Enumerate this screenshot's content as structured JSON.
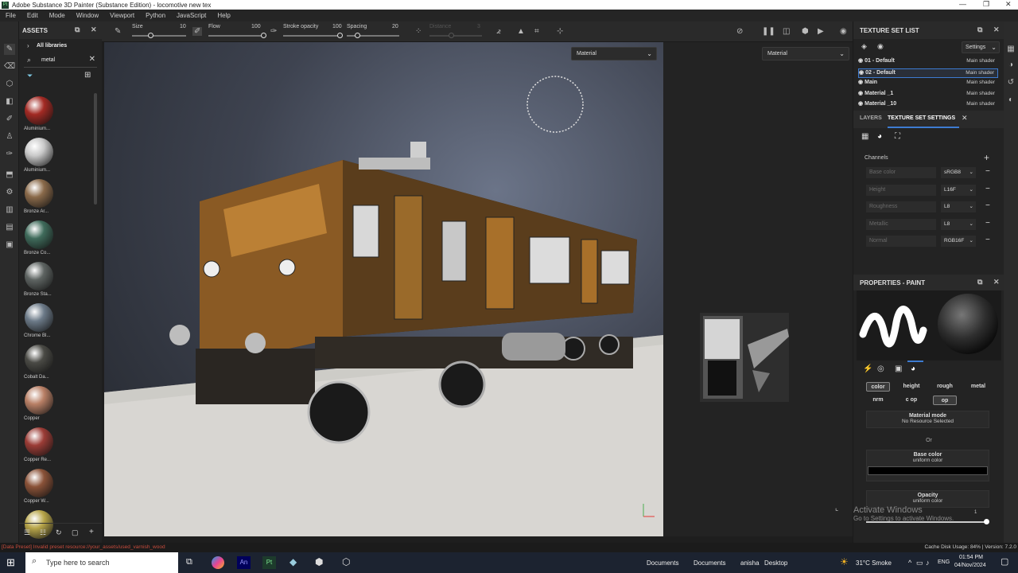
{
  "window": {
    "title": "Adobe Substance 3D Painter (Substance Edition) - locomotive new tex",
    "logo": "Pt"
  },
  "menu": [
    "File",
    "Edit",
    "Mode",
    "Window",
    "Viewport",
    "Python",
    "JavaScript",
    "Help"
  ],
  "assets": {
    "title": "ASSETS",
    "library": "All libraries",
    "search_value": "metal",
    "items": [
      {
        "label": "Aluminium...",
        "color": "#a32a24"
      },
      {
        "label": "Aluminium...",
        "color": "#c9c9c9"
      },
      {
        "label": "Bronze Ar...",
        "color": "#8a6a4a"
      },
      {
        "label": "Bronze Co...",
        "color": "#3f6b5b"
      },
      {
        "label": "Bronze Sta...",
        "color": "#5e6462"
      },
      {
        "label": "Chrome Bl...",
        "color": "#6c7a88"
      },
      {
        "label": "Cobalt Da...",
        "color": "#4a4a45"
      },
      {
        "label": "Copper",
        "color": "#b98066"
      },
      {
        "label": "Copper Re...",
        "color": "#9b3c36"
      },
      {
        "label": "Copper W...",
        "color": "#8a5238"
      },
      {
        "label": "",
        "color": "#b8a64a"
      }
    ]
  },
  "toolbar": {
    "size_label": "Size",
    "size_value": "10",
    "flow_label": "Flow",
    "flow_value": "100",
    "stroke_opacity_label": "Stroke opacity",
    "stroke_opacity_value": "100",
    "spacing_label": "Spacing",
    "spacing_value": "20",
    "distance_label": "Distance",
    "distance_value": "3"
  },
  "viewport": {
    "mode_left": "Material",
    "mode_right": "Material"
  },
  "texture_set_list": {
    "title": "TEXTURE SET LIST",
    "settings": "Settings",
    "rows": [
      {
        "name": "01 - Default",
        "shader": "Main shader"
      },
      {
        "name": "02 - Default",
        "shader": "Main shader"
      },
      {
        "name": "Main",
        "shader": "Main shader"
      },
      {
        "name": "Material _1",
        "shader": "Main shader"
      },
      {
        "name": "Material _10",
        "shader": "Main shader"
      }
    ]
  },
  "tabs": {
    "layers": "LAYERS",
    "texture_set_settings": "TEXTURE SET SETTINGS"
  },
  "channels": {
    "title": "Channels",
    "rows": [
      {
        "name": "Base color",
        "format": "sRGB8"
      },
      {
        "name": "Height",
        "format": "L16F"
      },
      {
        "name": "Roughness",
        "format": "L8"
      },
      {
        "name": "Metallic",
        "format": "L8"
      },
      {
        "name": "Normal",
        "format": "RGB16F"
      }
    ]
  },
  "properties": {
    "title": "PROPERTIES - PAINT",
    "chips_row1": [
      "color",
      "height",
      "rough",
      "metal"
    ],
    "chips_row2": [
      "nrm",
      "c op",
      "op"
    ],
    "material_mode_title": "Material mode",
    "material_mode_value": "No Resource Selected",
    "or": "Or",
    "base_color_title": "Base color",
    "base_color_value": "uniform color",
    "base_color_swatch": "#000000",
    "opacity_title": "Opacity",
    "opacity_value": "uniform color",
    "opacity_slider_value": "1"
  },
  "watermark": {
    "line1": "Activate Windows",
    "line2": "Go to Settings to activate Windows."
  },
  "status": {
    "error": "[Data Preset] Invalid preset resource://your_assets/used_varnish_wood",
    "disk": "Cache Disk Usage:  84% | Version: 7.2.0"
  },
  "taskbar": {
    "search": "Type here to search",
    "items": [
      "Documents",
      "Documents",
      "anisha",
      "Desktop"
    ],
    "weather": "31°C Smoke",
    "lang": "ENG",
    "time": "01:54 PM",
    "date": "04/Nov/2024"
  }
}
